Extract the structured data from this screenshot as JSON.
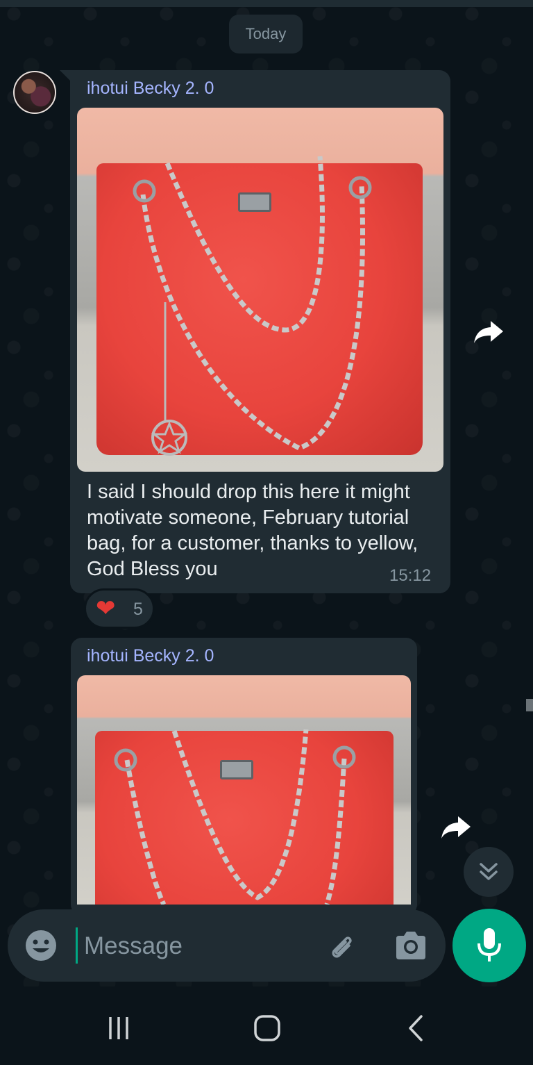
{
  "date_chip": "Today",
  "messages": [
    {
      "sender": "ihotui Becky 2. 0",
      "text": "I said I should drop this here it might motivate someone, February tutorial bag, for a customer, thanks to yellow, God Bless you",
      "time": "15:12",
      "image_alt": "red handbag with chain straps",
      "reaction": {
        "emoji": "❤",
        "count": "5"
      }
    },
    {
      "sender": "ihotui Becky 2. 0",
      "image_alt": "red handbag with chain straps"
    }
  ],
  "composer": {
    "placeholder": "Message"
  },
  "icons": {
    "emoji": "emoji-icon",
    "attach": "paperclip-icon",
    "camera": "camera-icon",
    "mic": "mic-icon",
    "forward": "forward-icon",
    "scroll_down": "double-chevron-down-icon"
  },
  "colors": {
    "background": "#0b141a",
    "bubble": "#202c33",
    "accent": "#00a884",
    "sender": "#a5b5ff",
    "text": "#e9edef",
    "muted": "#8696a0"
  }
}
